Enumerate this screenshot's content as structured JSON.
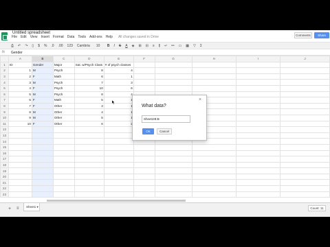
{
  "doc_title": "Untitled spreadsheet",
  "menu": [
    "File",
    "Edit",
    "View",
    "Insert",
    "Format",
    "Data",
    "Tools",
    "Add-ons",
    "Help"
  ],
  "saved_status": "All changes saved in Drive",
  "comments_label": "Comments",
  "share_label": "Share",
  "toolbar": {
    "print_icon": "print-icon",
    "undo_icon": "undo-icon",
    "redo_icon": "redo-icon",
    "currency": "$",
    "percent": "%",
    "decimal_decrease": ".0",
    "decimal_increase": ".00",
    "number_format": "123",
    "font": "Cambria",
    "font_size": "10",
    "bold": "B",
    "italic": "I",
    "strike": "S",
    "text_color": "A",
    "functions": "Σ"
  },
  "formula_bar": {
    "fx": "fx",
    "value": "Gender"
  },
  "columns": [
    "",
    "A",
    "B",
    "C",
    "D",
    "E",
    "F",
    "G",
    "H",
    "I",
    "J"
  ],
  "rows": [
    [
      "1",
      "ID",
      "Gender",
      "Major",
      "Sat. w/Psych Class",
      "# of psych classes",
      "",
      "",
      "",
      "",
      ""
    ],
    [
      "2",
      "1",
      "M",
      "Psych",
      "8",
      "4",
      "",
      "",
      "",
      "",
      ""
    ],
    [
      "3",
      "2",
      "F",
      "Math",
      "6",
      "1",
      "",
      "",
      "",
      "",
      ""
    ],
    [
      "4",
      "3",
      "M",
      "Psych",
      "7",
      "3",
      "",
      "",
      "",
      "",
      ""
    ],
    [
      "5",
      "4",
      "F",
      "Psych",
      "10",
      "6",
      "",
      "",
      "",
      "",
      ""
    ],
    [
      "6",
      "5",
      "M",
      "Psych",
      "8",
      "4",
      "",
      "",
      "",
      "",
      ""
    ],
    [
      "7",
      "6",
      "F",
      "Math",
      "5",
      "1",
      "",
      "",
      "",
      "",
      ""
    ],
    [
      "8",
      "7",
      "F",
      "Other",
      "3",
      "1",
      "",
      "",
      "",
      "",
      ""
    ],
    [
      "9",
      "8",
      "M",
      "Other",
      "4",
      "1",
      "",
      "",
      "",
      "",
      ""
    ],
    [
      "10",
      "9",
      "M",
      "Other",
      "5",
      "1",
      "",
      "",
      "",
      "",
      ""
    ],
    [
      "11",
      "10",
      "F",
      "Other",
      "6",
      "2",
      "",
      "",
      "",
      "",
      ""
    ],
    [
      "12",
      "",
      "",
      "",
      "",
      "",
      "",
      "",
      "",
      "",
      ""
    ],
    [
      "13",
      "",
      "",
      "",
      "",
      "",
      "",
      "",
      "",
      "",
      ""
    ],
    [
      "14",
      "",
      "",
      "",
      "",
      "",
      "",
      "",
      "",
      "",
      ""
    ],
    [
      "15",
      "",
      "",
      "",
      "",
      "",
      "",
      "",
      "",
      "",
      ""
    ],
    [
      "16",
      "",
      "",
      "",
      "",
      "",
      "",
      "",
      "",
      "",
      ""
    ],
    [
      "17",
      "",
      "",
      "",
      "",
      "",
      "",
      "",
      "",
      "",
      ""
    ],
    [
      "18",
      "",
      "",
      "",
      "",
      "",
      "",
      "",
      "",
      "",
      ""
    ],
    [
      "19",
      "",
      "",
      "",
      "",
      "",
      "",
      "",
      "",
      "",
      ""
    ],
    [
      "20",
      "",
      "",
      "",
      "",
      "",
      "",
      "",
      "",
      "",
      ""
    ],
    [
      "21",
      "",
      "",
      "",
      "",
      "",
      "",
      "",
      "",
      "",
      ""
    ],
    [
      "22",
      "",
      "",
      "",
      "",
      "",
      "",
      "",
      "",
      "",
      ""
    ],
    [
      "23",
      "",
      "",
      "",
      "",
      "",
      "",
      "",
      "",
      "",
      ""
    ]
  ],
  "dialog": {
    "title": "What data?",
    "range": "Sheet1!B:B",
    "ok_label": "OK",
    "cancel_label": "Cancel",
    "close_icon": "close-icon"
  },
  "sheet_tab": "Sheet1",
  "count": "Count: 11",
  "colors": {
    "accent": "#4d90fe",
    "selected_column": "#e8f0fe",
    "sheets_green": "#0f9d58"
  }
}
